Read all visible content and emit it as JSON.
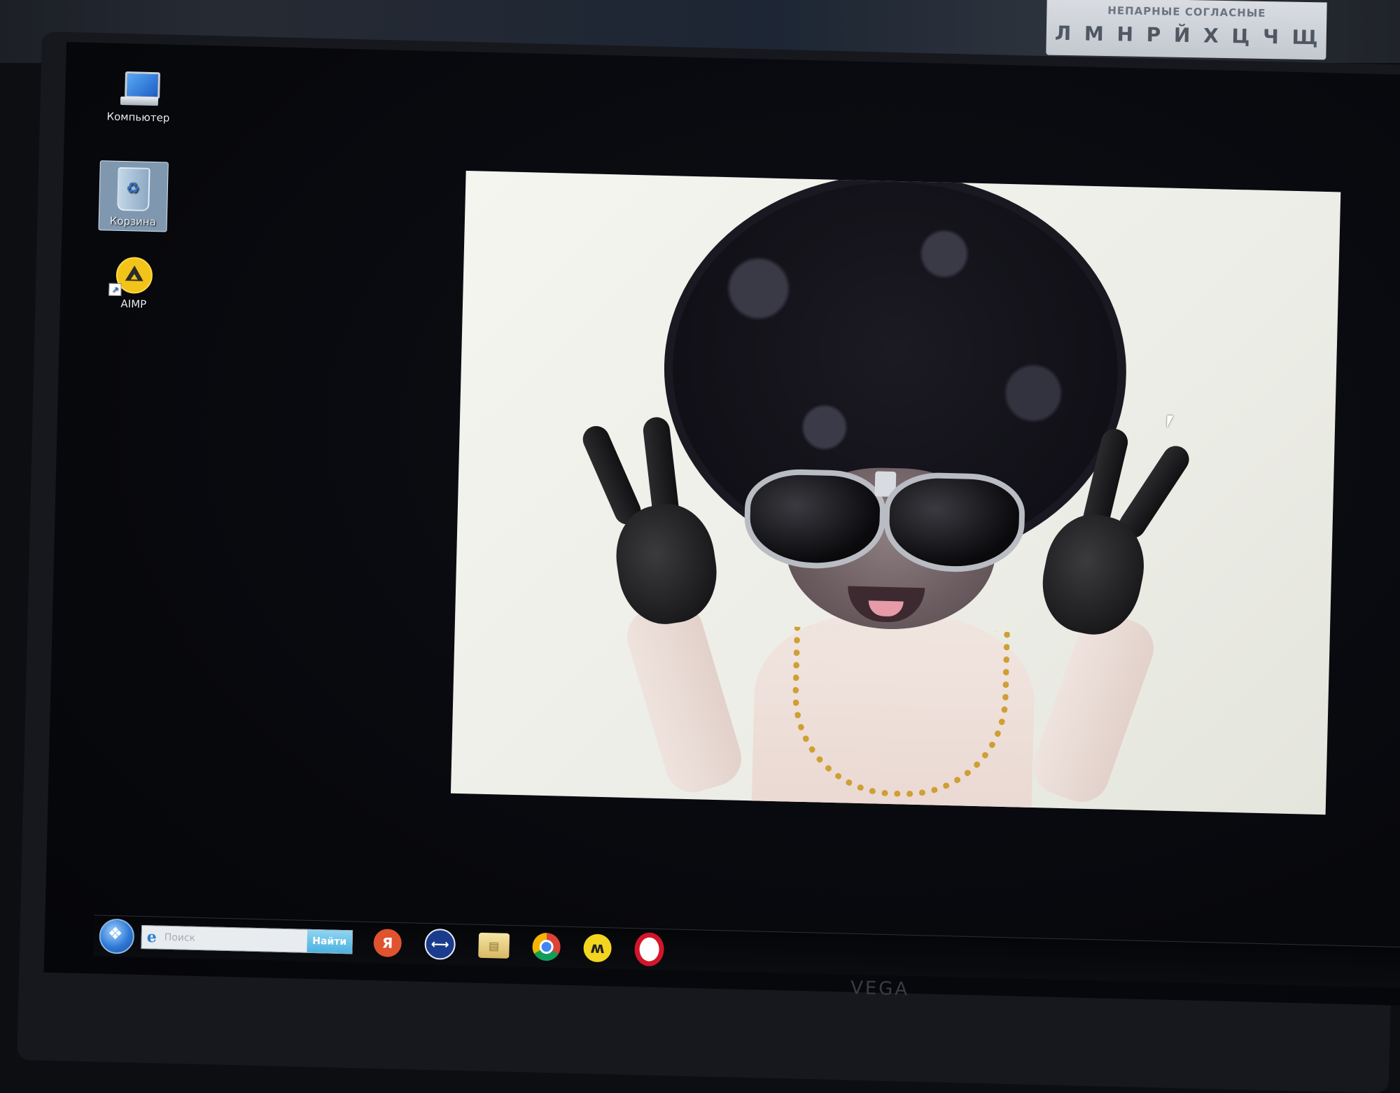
{
  "poster": {
    "title": "НЕПАРНЫЕ СОГЛАСНЫЕ",
    "letters": [
      "Л",
      "М",
      "Н",
      "Р",
      "Й",
      "Х",
      "Ц",
      "Ч",
      "Щ"
    ]
  },
  "desktop": {
    "icons": [
      {
        "label": "Компьютер",
        "icon": "computer-icon"
      },
      {
        "label": "Корзина",
        "icon": "recycle-bin-icon",
        "selected": true
      },
      {
        "label": "AIMP",
        "icon": "aimp-icon",
        "shortcut": true
      }
    ]
  },
  "taskbar": {
    "search": {
      "placeholder": "Поиск",
      "button_label": "Найти"
    },
    "pinned": [
      {
        "icon": "yandex-icon",
        "glyph": "Я"
      },
      {
        "icon": "teamviewer-icon",
        "glyph": "⟷"
      },
      {
        "icon": "folder-icon",
        "glyph": "▤"
      },
      {
        "icon": "chrome-icon",
        "glyph": ""
      },
      {
        "icon": "yandex-browser-icon",
        "glyph": "ʍ"
      },
      {
        "icon": "opera-icon",
        "glyph": ""
      }
    ]
  },
  "monitor": {
    "brand": "VEGA"
  },
  "colors": {
    "screen_bg": "#07080c",
    "taskbar_bg": "#050608",
    "search_button": "#4bb2e0"
  }
}
